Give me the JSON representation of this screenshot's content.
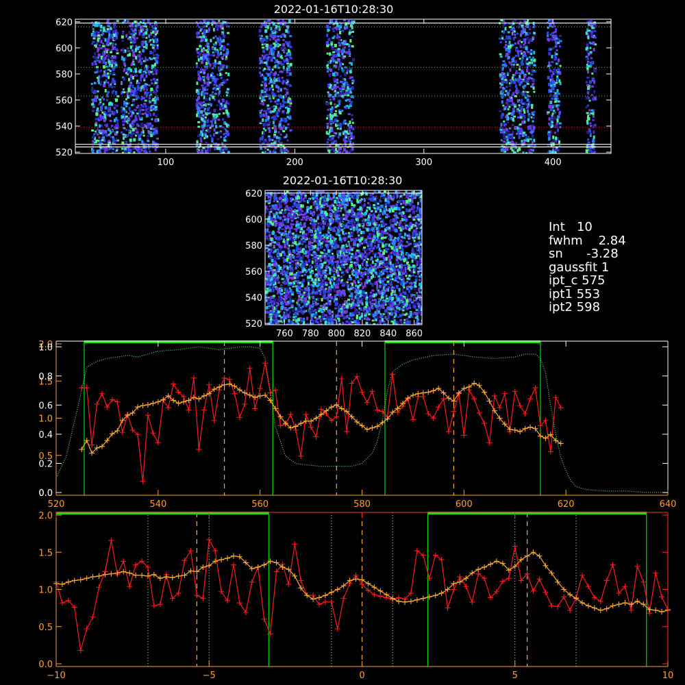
{
  "chart_data": [
    {
      "type": "heatmap",
      "title": "2022-01-16T10:28:30",
      "xlim": [
        30,
        445
      ],
      "ylim": [
        519,
        622
      ],
      "xticks": [
        100,
        200,
        300,
        400
      ],
      "yticks": [
        520,
        540,
        560,
        580,
        600,
        620
      ],
      "bright_column_bands": [
        [
          42,
          62
        ],
        [
          65,
          93
        ],
        [
          123,
          148
        ],
        [
          172,
          196
        ],
        [
          224,
          245
        ],
        [
          358,
          385
        ],
        [
          395,
          405
        ],
        [
          425,
          432
        ]
      ],
      "white_lines": [
        619,
        526,
        524
      ],
      "green_dotted_lines": [
        616,
        585,
        563
      ],
      "red_dotted_line": 539
    },
    {
      "type": "heatmap",
      "title": "2022-01-16T10:28:30",
      "xlim": [
        745,
        866
      ],
      "ylim": [
        519,
        622
      ],
      "xticks": [
        760,
        780,
        800,
        820,
        840,
        860
      ],
      "yticks": [
        520,
        540,
        560,
        580,
        600,
        620
      ],
      "white_lines": [
        620
      ],
      "green_dotted_lines": [
        616,
        585,
        563
      ],
      "red_dotted_line": 539
    },
    {
      "type": "line",
      "xlim": [
        520,
        640
      ],
      "ylim_left": [
        0,
        2.0
      ],
      "ylim_right": [
        0,
        1.02
      ],
      "xticks": [
        520,
        540,
        560,
        580,
        600,
        620,
        640
      ],
      "yticks_left": [
        "0.0",
        "0.5",
        "1.0",
        "1.5",
        "2.0"
      ],
      "yticks_right": [
        "0.0",
        "0.2",
        "0.4",
        "0.6",
        "0.8",
        "1.0"
      ],
      "green_windows": [
        [
          525.5,
          562.5
        ],
        [
          584.5,
          615
        ]
      ],
      "dashed_markers": [
        553,
        575,
        598
      ],
      "x": [
        525,
        526,
        527,
        528,
        529,
        530,
        531,
        532,
        533,
        534,
        535,
        536,
        537,
        538,
        539,
        540,
        541,
        542,
        543,
        544,
        545,
        546,
        547,
        548,
        549,
        550,
        551,
        552,
        553,
        554,
        555,
        556,
        557,
        558,
        559,
        560,
        561,
        562,
        563,
        564,
        565,
        566,
        567,
        568,
        569,
        570,
        571,
        572,
        573,
        574,
        575,
        576,
        577,
        578,
        579,
        580,
        581,
        582,
        583,
        584,
        585,
        586,
        587,
        588,
        589,
        590,
        591,
        592,
        593,
        594,
        595,
        596,
        597,
        598,
        599,
        600,
        601,
        602,
        603,
        604,
        605,
        606,
        607,
        608,
        609,
        610,
        611,
        612,
        613,
        614,
        615,
        616,
        617,
        618,
        619
      ],
      "series": [
        {
          "color": "#ff1a1a",
          "values": [
            1.41,
            1.41,
            0.64,
            1.19,
            1.33,
            1.15,
            1.25,
            1.22,
            0.81,
            1.05,
            0.84,
            0.78,
            0.15,
            1.04,
            0.8,
            0.67,
            1.24,
            1.14,
            1.46,
            1.35,
            1.29,
            1.11,
            1.54,
            0.58,
            1.11,
            1.45,
            0.97,
            1.38,
            1.54,
            1.52,
            1.33,
            1.01,
            1.19,
            1.67,
            1.13,
            1.4,
            1.74,
            1.34,
            1.38,
            0.9,
            0.92,
            1.05,
            0.84,
            0.49,
            1.05,
            0.88,
            0.75,
            1.12,
            1.06,
            0.97,
            1.02,
            1.53,
            0.82,
            1.47,
            1.56,
            1.35,
            1.21,
            1.36,
            1.11,
            1.09,
            1.02,
            1.59,
            1.08,
            1.16,
            1.26,
            0.98,
            1.29,
            1.29,
            1.06,
            1.0,
            1.15,
            1.26,
            0.82,
            1.09,
            1.33,
            0.77,
            1.38,
            1.26,
            1.07,
            0.93,
            0.67,
            1.3,
            1.14,
            1.33,
            0.82,
            1.36,
            1.17,
            1.06,
            1.26,
            1.41,
            0.9,
            0.97,
            0.55,
            1.28,
            1.14
          ]
        },
        {
          "color": "#ffaa33",
          "values": [
            0.58,
            0.7,
            0.53,
            0.6,
            0.62,
            0.7,
            0.79,
            0.83,
            0.97,
            1.04,
            1.07,
            1.15,
            1.17,
            1.18,
            1.2,
            1.22,
            1.25,
            1.3,
            1.24,
            1.2,
            1.22,
            1.24,
            1.28,
            1.26,
            1.3,
            1.33,
            1.39,
            1.42,
            1.45,
            1.46,
            1.43,
            1.38,
            1.34,
            1.31,
            1.28,
            1.3,
            1.31,
            1.24,
            1.13,
            1.02,
            0.93,
            0.87,
            0.89,
            0.93,
            0.96,
            0.96,
            1.0,
            1.05,
            1.1,
            1.15,
            1.18,
            1.13,
            1.09,
            1.02,
            0.95,
            0.9,
            0.85,
            0.87,
            0.89,
            0.94,
            0.99,
            1.08,
            1.13,
            1.2,
            1.27,
            1.31,
            1.33,
            1.34,
            1.35,
            1.37,
            1.4,
            1.34,
            1.27,
            1.23,
            1.34,
            1.4,
            1.42,
            1.47,
            1.44,
            1.35,
            1.23,
            1.1,
            1.0,
            0.92,
            0.85,
            0.84,
            0.82,
            0.86,
            0.88,
            0.86,
            0.76,
            0.73,
            0.78,
            0.7,
            0.66
          ]
        },
        {
          "color": "#66dd66",
          "style": "dotted",
          "x": [
            520,
            522,
            524,
            526,
            528,
            530,
            532,
            534,
            536,
            538,
            540,
            544,
            548,
            552,
            556,
            558,
            560,
            561,
            562,
            563,
            565,
            567,
            569,
            572,
            575,
            578,
            580,
            582,
            583,
            584,
            585,
            586,
            588,
            590,
            594,
            598,
            602,
            606,
            610,
            612,
            614,
            615,
            616,
            617,
            618,
            619,
            620,
            621,
            622,
            624,
            628,
            632,
            636,
            640
          ],
          "values": [
            0.1,
            0.25,
            0.55,
            0.86,
            0.9,
            0.92,
            0.93,
            0.94,
            0.93,
            0.95,
            0.97,
            0.98,
            1.0,
            0.98,
            1.0,
            1.0,
            0.99,
            0.92,
            0.7,
            0.45,
            0.25,
            0.2,
            0.19,
            0.18,
            0.18,
            0.18,
            0.2,
            0.27,
            0.35,
            0.5,
            0.7,
            0.83,
            0.88,
            0.91,
            0.94,
            0.95,
            0.93,
            0.92,
            0.93,
            0.95,
            0.95,
            0.92,
            0.82,
            0.6,
            0.4,
            0.24,
            0.15,
            0.08,
            0.04,
            0.02,
            0.01,
            0.01,
            0.0,
            0.0
          ]
        }
      ]
    },
    {
      "type": "line",
      "xlim": [
        -10,
        10
      ],
      "ylim": [
        0,
        2.0
      ],
      "xticks": [
        -10,
        -5,
        0,
        5,
        10
      ],
      "yticks": [
        "0.0",
        "0.5",
        "1.0",
        "1.5",
        "2.0"
      ],
      "green_windows": [
        [
          -3.05,
          2.15
        ],
        [
          2.15,
          9.3
        ]
      ],
      "dashed_markers": [
        -5.4,
        0,
        5.4
      ],
      "dotted_markers": [
        -7,
        -5,
        -1,
        1,
        5,
        7
      ],
      "x_start": -10,
      "x_step": 0.2,
      "series": [
        {
          "color": "#ff1a1a",
          "values": [
            1.1,
            0.82,
            0.85,
            0.76,
            0.18,
            0.47,
            0.63,
            1.03,
            1.24,
            1.66,
            1.2,
            1.38,
            1.04,
            1.33,
            1.38,
            1.3,
            0.78,
            0.8,
            1.2,
            0.88,
            0.95,
            1.39,
            1.52,
            0.92,
            0.88,
            1.67,
            1.52,
            0.97,
            0.85,
            1.33,
            0.82,
            0.69,
            1.1,
            1.3,
            0.6,
            0.4,
            1.24,
            1.34,
            1.07,
            1.61,
            1.12,
            0.92,
            0.92,
            0.8,
            0.83,
            0.83,
            0.47,
            0.88,
            1.08,
            1.19,
            1.07,
            0.99,
            0.93,
            0.91,
            0.89,
            0.86,
            0.89,
            0.87,
            0.95,
            1.52,
            1.46,
            1.15,
            1.46,
            1.4,
            0.75,
            1.0,
            1.17,
            1.04,
            0.83,
            1.21,
            1.15,
            0.89,
            0.97,
            1.11,
            1.15,
            1.58,
            1.12,
            1.21,
            0.98,
            1.14,
            0.96,
            0.78,
            0.77,
            0.9,
            0.72,
            0.89,
            1.19,
            1.04,
            0.89,
            0.84,
            1.12,
            1.33,
            0.95,
            1.04,
            0.72,
            1.31,
            1.1,
            0.68,
            1.22,
            0.9,
            0.73
          ]
        },
        {
          "color": "#ffaa33",
          "values": [
            1.08,
            1.07,
            1.1,
            1.12,
            1.13,
            1.15,
            1.17,
            1.18,
            1.2,
            1.21,
            1.22,
            1.24,
            1.22,
            1.19,
            1.19,
            1.18,
            1.2,
            1.15,
            1.17,
            1.16,
            1.18,
            1.19,
            1.25,
            1.24,
            1.3,
            1.32,
            1.38,
            1.4,
            1.42,
            1.45,
            1.44,
            1.36,
            1.28,
            1.3,
            1.33,
            1.38,
            1.36,
            1.3,
            1.27,
            1.18,
            1.02,
            0.92,
            0.87,
            0.89,
            0.92,
            0.96,
            1.0,
            1.05,
            1.12,
            1.14,
            1.13,
            1.08,
            1.03,
            0.98,
            0.93,
            0.88,
            0.84,
            0.83,
            0.84,
            0.86,
            0.88,
            0.9,
            0.92,
            0.95,
            1.0,
            1.08,
            1.1,
            1.15,
            1.22,
            1.27,
            1.3,
            1.34,
            1.38,
            1.35,
            1.26,
            1.31,
            1.4,
            1.45,
            1.5,
            1.45,
            1.32,
            1.22,
            1.1,
            1.0,
            0.93,
            0.88,
            0.82,
            0.78,
            0.75,
            0.72,
            0.74,
            0.78,
            0.8,
            0.82,
            0.8,
            0.84,
            0.8,
            0.73,
            0.72,
            0.7,
            0.72
          ]
        }
      ]
    }
  ],
  "params": [
    {
      "label": "Int",
      "value": "10"
    },
    {
      "label": "fwhm",
      "value": "2.84"
    },
    {
      "label": "sn",
      "value": "-3.28"
    },
    {
      "label": "gaussfit",
      "value": "1"
    },
    {
      "label": "ipt_c",
      "value": "575"
    },
    {
      "label": "ipt1",
      "value": "553"
    },
    {
      "label": "ipt2",
      "value": "598"
    }
  ],
  "colors": {
    "red": "#ff1a1a",
    "orange": "#ffaa33",
    "green": "#00ee00",
    "axis_top": "#ffffff",
    "axis_bottom": "#ffa030",
    "axis_red": "#ff3030"
  }
}
